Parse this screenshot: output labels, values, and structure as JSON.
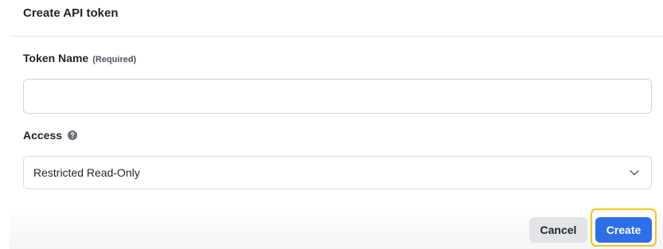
{
  "dialog": {
    "title": "Create API token"
  },
  "token_name": {
    "label": "Token Name",
    "required_label": "(Required)",
    "value": "",
    "placeholder": ""
  },
  "access": {
    "label": "Access",
    "help_icon": "question-circle-icon",
    "selected": "Restricted Read-Only",
    "dropdown_icon": "chevron-down-icon"
  },
  "actions": {
    "cancel_label": "Cancel",
    "create_label": "Create",
    "focused": "create",
    "focus_color": "#f5c518",
    "primary_color": "#2e6fe8"
  }
}
